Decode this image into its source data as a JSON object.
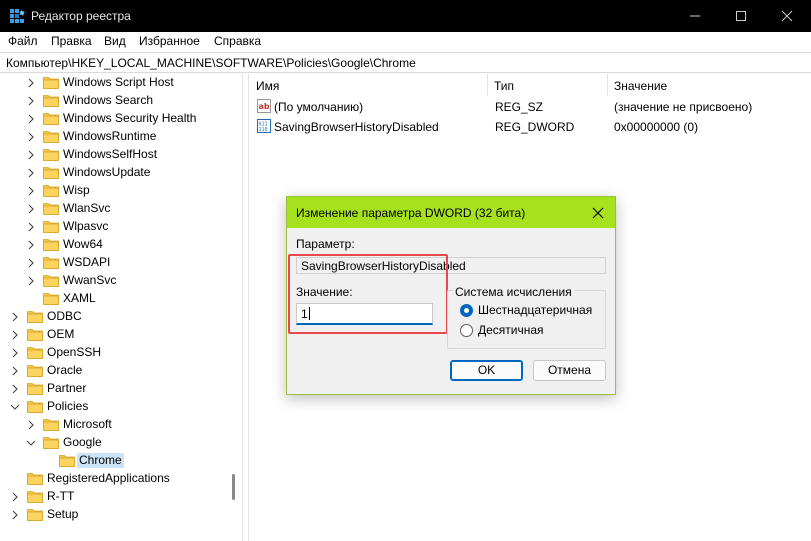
{
  "window": {
    "title": "Редактор реестра"
  },
  "menu": [
    "Файл",
    "Правка",
    "Вид",
    "Избранное",
    "Справка"
  ],
  "address": "Компьютер\\HKEY_LOCAL_MACHINE\\SOFTWARE\\Policies\\Google\\Chrome",
  "tree": [
    {
      "label": "Windows Script Host",
      "expandable": true
    },
    {
      "label": "Windows Search",
      "expandable": true
    },
    {
      "label": "Windows Security Health",
      "expandable": true
    },
    {
      "label": "WindowsRuntime",
      "expandable": true
    },
    {
      "label": "WindowsSelfHost",
      "expandable": true
    },
    {
      "label": "WindowsUpdate",
      "expandable": true
    },
    {
      "label": "Wisp",
      "expandable": true
    },
    {
      "label": "WlanSvc",
      "expandable": true
    },
    {
      "label": "Wlpasvc",
      "expandable": true
    },
    {
      "label": "Wow64",
      "expandable": true
    },
    {
      "label": "WSDAPI",
      "expandable": true
    },
    {
      "label": "WwanSvc",
      "expandable": true
    },
    {
      "label": "XAML",
      "expandable": false
    },
    {
      "label": "ODBC",
      "expandable": true
    },
    {
      "label": "OEM",
      "expandable": true
    },
    {
      "label": "OpenSSH",
      "expandable": true
    },
    {
      "label": "Oracle",
      "expandable": true
    },
    {
      "label": "Partner",
      "expandable": true
    },
    {
      "label": "Policies",
      "expandable": true,
      "expanded": true
    },
    {
      "label": "Microsoft",
      "expandable": true
    },
    {
      "label": "Google",
      "expandable": true,
      "expanded": true
    },
    {
      "label": "Chrome",
      "expandable": false,
      "selected": true
    },
    {
      "label": "RegisteredApplications",
      "expandable": false
    },
    {
      "label": "R-TT",
      "expandable": true
    },
    {
      "label": "Setup",
      "expandable": true
    }
  ],
  "columns": {
    "name": "Имя",
    "type": "Тип",
    "data": "Значение"
  },
  "values": [
    {
      "name": "(По умолчанию)",
      "type": "REG_SZ",
      "data": "(значение не присвоено)",
      "icon": "string-value-icon"
    },
    {
      "name": "SavingBrowserHistoryDisabled",
      "type": "REG_DWORD",
      "data": "0x00000000 (0)",
      "icon": "dword-value-icon"
    }
  ],
  "dialog": {
    "title": "Изменение параметра DWORD (32 бита)",
    "param_label": "Параметр:",
    "param_value": "SavingBrowserHistoryDisabled",
    "value_label": "Значение:",
    "value": "1",
    "base_title": "Система исчисления",
    "base_hex": "Шестнадцатеричная",
    "base_dec": "Десятичная",
    "ok": "OK",
    "cancel": "Отмена"
  },
  "colors": {
    "dialog_title": "#a5e21d",
    "accent": "#0067c0",
    "highlight": "#e8494b",
    "folder": "#f4c542"
  }
}
